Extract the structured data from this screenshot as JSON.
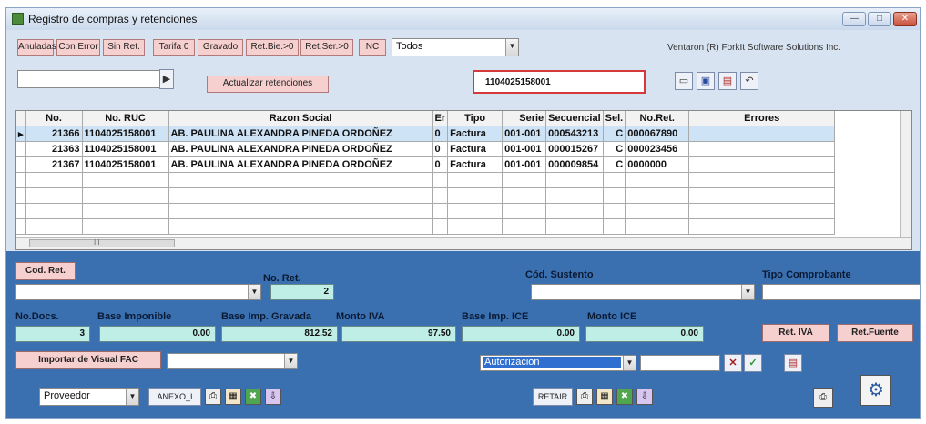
{
  "window": {
    "title": "Registro de compras y retenciones",
    "controls": [
      "—",
      "□",
      "✕"
    ]
  },
  "toolbar": {
    "filters": [
      "Anuladas",
      "Con Error",
      "Sin Ret.",
      "Tarifa 0",
      "Gravado",
      "Ret.Bie.>0",
      "Ret.Ser.>0",
      "NC"
    ],
    "filter_select": "Todos",
    "vendor": "Ventaron (R) ForkIt Software Solutions Inc.",
    "go_glyph": "▶",
    "update_button": "Actualizar retenciones",
    "ruc_search": "1104025158001"
  },
  "grid": {
    "columns": [
      "No.",
      "No. RUC",
      "Razon Social",
      "Er",
      "Tipo",
      "Serie",
      "Secuencial",
      "Sel.",
      "No.Ret.",
      "Errores"
    ],
    "rows": [
      {
        "no": "21366",
        "ruc": "1104025158001",
        "razon": "AB. PAULINA ALEXANDRA PINEDA ORDOÑEZ",
        "er": "0",
        "tipo": "Factura",
        "serie": "001-001",
        "secuencial": "000543213",
        "sel": "C",
        "noret": "000067890",
        "errores": ""
      },
      {
        "no": "21363",
        "ruc": "1104025158001",
        "razon": "AB. PAULINA ALEXANDRA PINEDA ORDOÑEZ",
        "er": "0",
        "tipo": "Factura",
        "serie": "001-001",
        "secuencial": "000015267",
        "sel": "C",
        "noret": "000023456",
        "errores": ""
      },
      {
        "no": "21367",
        "ruc": "1104025158001",
        "razon": "AB. PAULINA ALEXANDRA PINEDA ORDOÑEZ",
        "er": "0",
        "tipo": "Factura",
        "serie": "001-001",
        "secuencial": "000009854",
        "sel": "C",
        "noret": "0000000",
        "errores": ""
      }
    ],
    "scroll_thumb": "III"
  },
  "bottom": {
    "cod_ret_button": "Cod. Ret.",
    "no_ret_label": "No. Ret.",
    "no_ret_value": "2",
    "cod_sustento_label": "Cód. Sustento",
    "tipo_comprobante_label": "Tipo Comprobante",
    "no_docs_label": "No.Docs.",
    "no_docs_value": "3",
    "base_imponible_label": "Base Imponible",
    "base_imponible_value": "0.00",
    "base_imp_gravada_label": "Base Imp. Gravada",
    "base_imp_gravada_value": "812.52",
    "monto_iva_label": "Monto IVA",
    "monto_iva_value": "97.50",
    "base_imp_ice_label": "Base Imp. ICE",
    "base_imp_ice_value": "0.00",
    "monto_ice_label": "Monto ICE",
    "monto_ice_value": "0.00",
    "ret_iva_button": "Ret. IVA",
    "ret_fuente_button": "Ret.Fuente",
    "importar_button": "Importar de Visual FAC",
    "autorizacion_select": "Autorizacion",
    "proveedor_select": "Proveedor",
    "anexo_button": "ANEXO_I",
    "retair_button": "RETAIR"
  }
}
